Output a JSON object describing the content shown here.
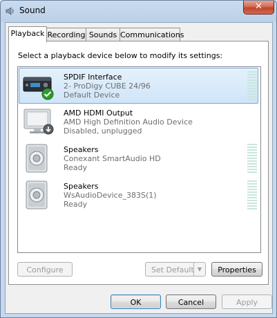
{
  "window": {
    "title": "Sound",
    "close_label": "✕"
  },
  "tabs": [
    {
      "label": "Playback",
      "active": true
    },
    {
      "label": "Recording",
      "active": false
    },
    {
      "label": "Sounds",
      "active": false
    },
    {
      "label": "Communications",
      "active": false
    }
  ],
  "instruction": "Select a playback device below to modify its settings:",
  "devices": [
    {
      "name": "SPDIF Interface",
      "line1": "2- ProDigy CUBE 24/96",
      "line2": "Default Device",
      "icon": "audio-receiver-icon",
      "badge": "default-check-icon",
      "selected": true
    },
    {
      "name": "AMD HDMI Output",
      "line1": "AMD High Definition Audio Device",
      "line2": "Disabled, unplugged",
      "icon": "monitor-icon",
      "badge": "unplugged-arrow-icon",
      "selected": false
    },
    {
      "name": "Speakers",
      "line1": "Conexant SmartAudio HD",
      "line2": "Ready",
      "icon": "speaker-icon",
      "selected": false
    },
    {
      "name": "Speakers",
      "line1": "WsAudioDevice_383S(1)",
      "line2": "Ready",
      "icon": "speaker-icon",
      "selected": false
    }
  ],
  "buttons": {
    "configure": "Configure",
    "set_default": "Set Default",
    "properties": "Properties",
    "ok": "OK",
    "cancel": "Cancel",
    "apply": "Apply"
  },
  "colors": {
    "selection": "#cfe5f8",
    "meter": "#c6e7db",
    "close": "#c0442d"
  }
}
